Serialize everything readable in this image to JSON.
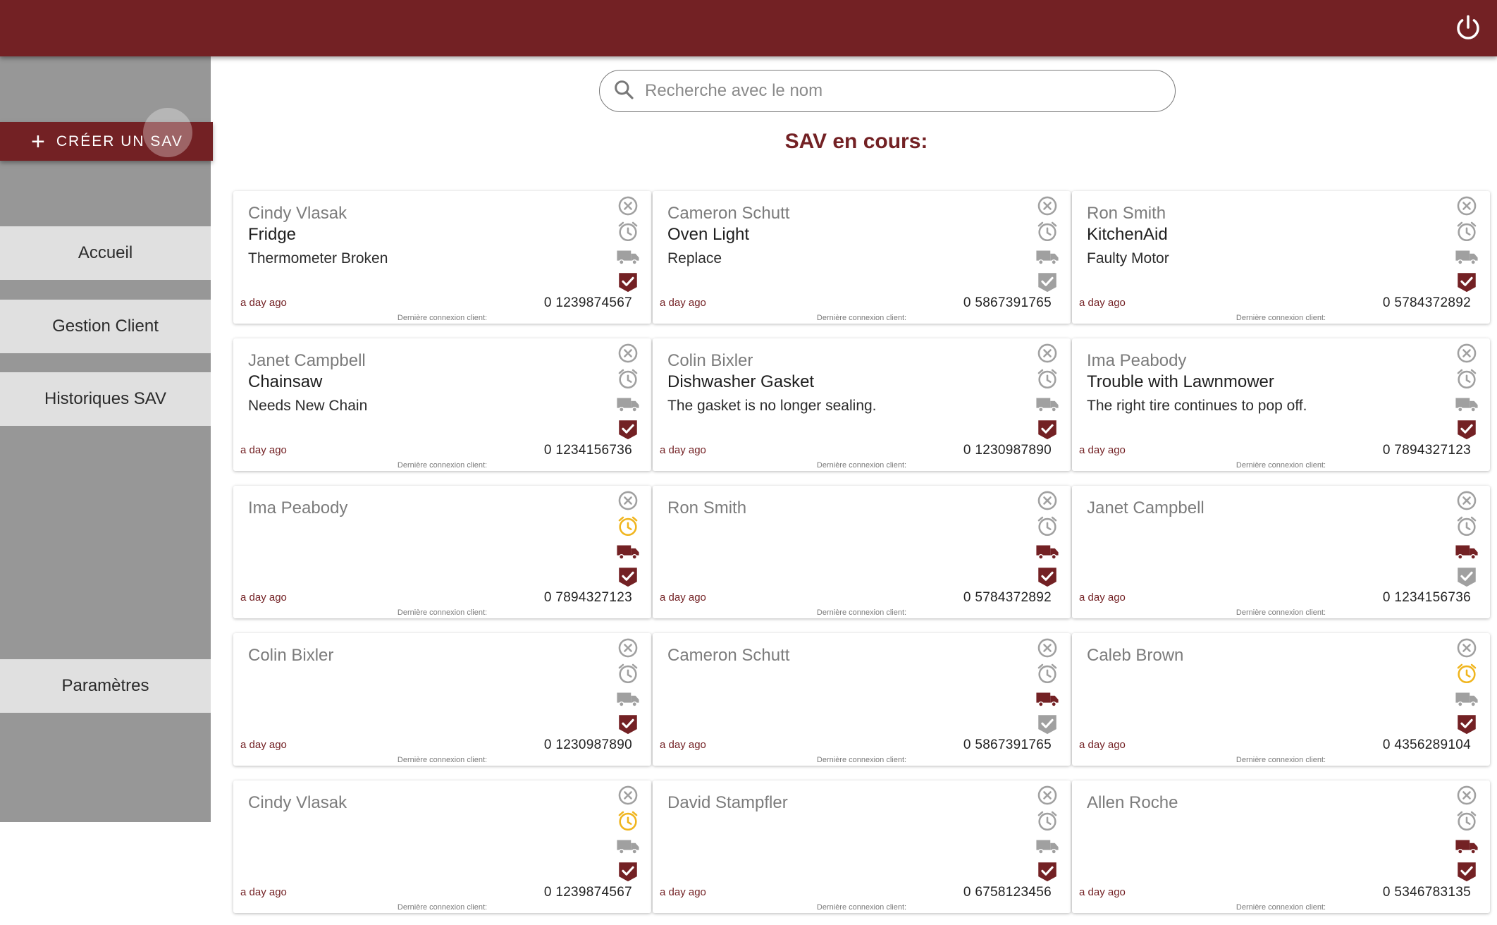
{
  "header": {
    "power_icon": "power-icon"
  },
  "sidebar": {
    "create_label": "CRÉER UN SAV",
    "items": [
      {
        "label": "Accueil"
      },
      {
        "label": "Gestion Client"
      },
      {
        "label": "Historiques SAV"
      },
      {
        "label": "Paramètres"
      }
    ]
  },
  "search": {
    "placeholder": "Recherche avec le nom"
  },
  "main": {
    "title": "SAV en cours:"
  },
  "colors": {
    "brand": "#732124",
    "inactive": "#a0a0a0",
    "warning": "#f0b51e"
  },
  "cards": [
    {
      "name": "Cindy Vlasak",
      "product": "Fridge",
      "issue": "Thermometer Broken",
      "time": "a day ago",
      "phone": "0 1239874567",
      "conn": "Dernière connexion client:",
      "alarm": "grey",
      "truck": "grey",
      "check": "red"
    },
    {
      "name": "Cameron Schutt",
      "product": "Oven Light",
      "issue": "Replace",
      "time": "a day ago",
      "phone": "0 5867391765",
      "conn": "Dernière connexion client:",
      "alarm": "grey",
      "truck": "grey",
      "check": "grey"
    },
    {
      "name": "Ron Smith",
      "product": "KitchenAid",
      "issue": "Faulty Motor",
      "time": "a day ago",
      "phone": "0 5784372892",
      "conn": "Dernière connexion client:",
      "alarm": "grey",
      "truck": "grey",
      "check": "red"
    },
    {
      "name": "Janet Campbell",
      "product": "Chainsaw",
      "issue": "Needs New Chain",
      "time": "a day ago",
      "phone": "0 1234156736",
      "conn": "Dernière connexion client:",
      "alarm": "grey",
      "truck": "grey",
      "check": "red"
    },
    {
      "name": "Colin Bixler",
      "product": "Dishwasher Gasket",
      "issue": "The gasket is no longer sealing.",
      "time": "a day ago",
      "phone": "0 1230987890",
      "conn": "Dernière connexion client:",
      "alarm": "grey",
      "truck": "grey",
      "check": "red"
    },
    {
      "name": "Ima Peabody",
      "product": "Trouble with Lawnmower",
      "issue": "The right tire continues to pop off.",
      "time": "a day ago",
      "phone": "0 7894327123",
      "conn": "Dernière connexion client:",
      "alarm": "grey",
      "truck": "grey",
      "check": "red"
    },
    {
      "name": "Ima Peabody",
      "product": "",
      "issue": "",
      "time": "a day ago",
      "phone": "0 7894327123",
      "conn": "Dernière connexion client:",
      "alarm": "yellow",
      "truck": "red",
      "check": "red"
    },
    {
      "name": "Ron Smith",
      "product": "",
      "issue": "",
      "time": "a day ago",
      "phone": "0 5784372892",
      "conn": "Dernière connexion client:",
      "alarm": "grey",
      "truck": "red",
      "check": "red"
    },
    {
      "name": "Janet Campbell",
      "product": "",
      "issue": "",
      "time": "a day ago",
      "phone": "0 1234156736",
      "conn": "Dernière connexion client:",
      "alarm": "grey",
      "truck": "red",
      "check": "grey"
    },
    {
      "name": "Colin Bixler",
      "product": "",
      "issue": "",
      "time": "a day ago",
      "phone": "0 1230987890",
      "conn": "Dernière connexion client:",
      "alarm": "grey",
      "truck": "grey",
      "check": "red"
    },
    {
      "name": "Cameron Schutt",
      "product": "",
      "issue": "",
      "time": "a day ago",
      "phone": "0 5867391765",
      "conn": "Dernière connexion client:",
      "alarm": "grey",
      "truck": "red",
      "check": "grey"
    },
    {
      "name": "Caleb Brown",
      "product": "",
      "issue": "",
      "time": "a day ago",
      "phone": "0 4356289104",
      "conn": "Dernière connexion client:",
      "alarm": "yellow",
      "truck": "grey",
      "check": "red"
    },
    {
      "name": "Cindy Vlasak",
      "product": "",
      "issue": "",
      "time": "a day ago",
      "phone": "0 1239874567",
      "conn": "Dernière connexion client:",
      "alarm": "yellow",
      "truck": "grey",
      "check": "red"
    },
    {
      "name": "David Stampfler",
      "product": "",
      "issue": "",
      "time": "a day ago",
      "phone": "0 6758123456",
      "conn": "Dernière connexion client:",
      "alarm": "grey",
      "truck": "grey",
      "check": "red"
    },
    {
      "name": "Allen Roche",
      "product": "",
      "issue": "",
      "time": "a day ago",
      "phone": "0 5346783135",
      "conn": "Dernière connexion client:",
      "alarm": "grey",
      "truck": "red",
      "check": "red"
    }
  ]
}
